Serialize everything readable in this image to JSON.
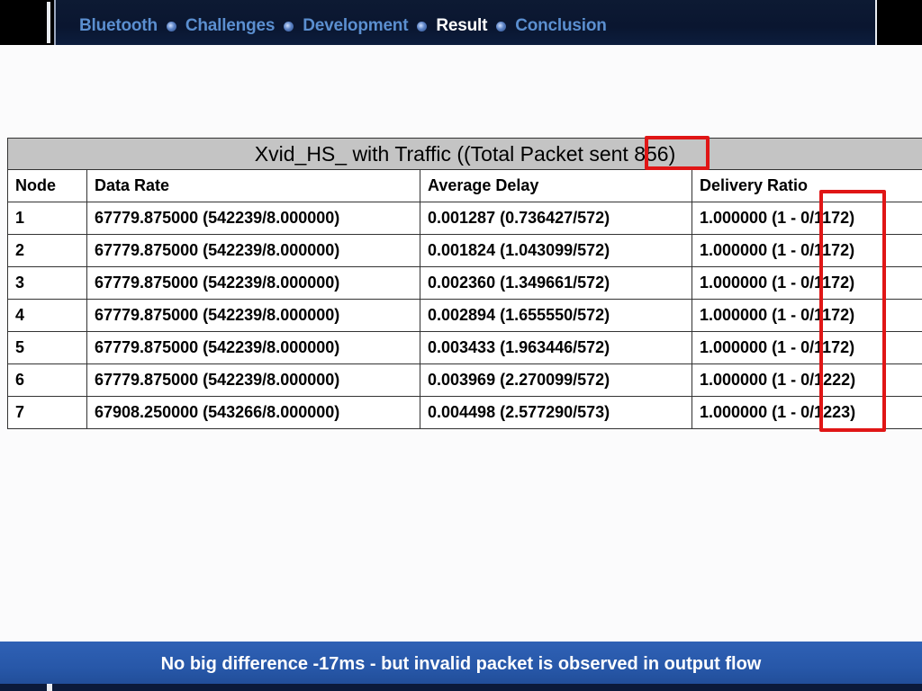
{
  "nav": {
    "items": [
      "Bluetooth",
      "Challenges",
      "Development",
      "Result",
      "Conclusion"
    ],
    "active": "Result"
  },
  "table": {
    "caption": "Xvid_HS_ with Traffic ((Total Packet sent 856)",
    "headers": [
      "Node",
      "Data Rate",
      "Average Delay",
      "Delivery Ratio"
    ],
    "rows": [
      [
        "1",
        "67779.875000  (542239/8.000000)",
        "0.001287  (0.736427/572)",
        "1.000000  (1 - 0/1172)"
      ],
      [
        "2",
        "67779.875000  (542239/8.000000)",
        "0.001824  (1.043099/572)",
        "1.000000  (1 - 0/1172)"
      ],
      [
        "3",
        "67779.875000  (542239/8.000000)",
        "0.002360  (1.349661/572)",
        "1.000000  (1 - 0/1172)"
      ],
      [
        "4",
        "67779.875000  (542239/8.000000)",
        "0.002894  (1.655550/572)",
        "1.000000  (1 - 0/1172)"
      ],
      [
        "5",
        "67779.875000  (542239/8.000000)",
        "0.003433  (1.963446/572)",
        "1.000000  (1 - 0/1172)"
      ],
      [
        "6",
        "67779.875000  (542239/8.000000)",
        "0.003969  (2.270099/572)",
        "1.000000  (1 - 0/1222)"
      ],
      [
        "7",
        "67908.250000  (543266/8.000000)",
        "0.004498  (2.577290/573)",
        "1.000000  (1 - 0/1223)"
      ]
    ]
  },
  "highlight_color": "#e01616",
  "footer": {
    "message": "No big difference -17ms - but invalid packet is observed in output flow"
  }
}
